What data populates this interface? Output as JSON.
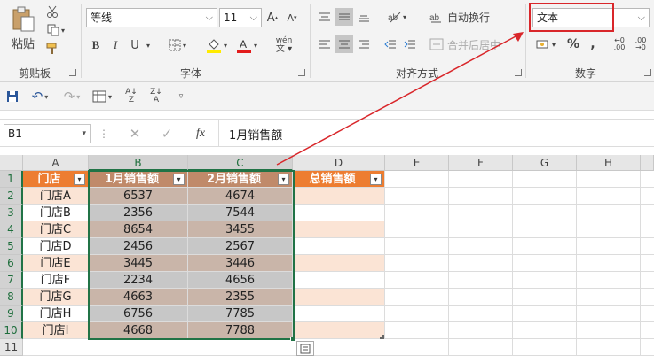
{
  "ribbon": {
    "clipboard": {
      "paste_label": "粘贴",
      "group_label": "剪贴板"
    },
    "font": {
      "font_name": "等线",
      "font_size": "11",
      "group_label": "字体",
      "bold": "B",
      "italic": "I",
      "underline": "U",
      "grow": "A",
      "shrink": "A",
      "phonetic": "wén"
    },
    "alignment": {
      "wrap_text": "自动换行",
      "merge_center": "合并后居中",
      "group_label": "对齐方式"
    },
    "number": {
      "format_value": "文本",
      "percent": "%",
      "comma": ",",
      "group_label": "数字"
    }
  },
  "formula_bar": {
    "name_box": "B1",
    "fx": "fx",
    "formula": "1月销售额"
  },
  "sheet": {
    "columns": [
      "A",
      "B",
      "C",
      "D",
      "E",
      "F",
      "G",
      "H"
    ],
    "rows": [
      "1",
      "2",
      "3",
      "4",
      "5",
      "6",
      "7",
      "8",
      "9",
      "10",
      "11"
    ],
    "headers": [
      "门店",
      "1月销售额",
      "2月销售额",
      "总销售额"
    ],
    "data": [
      {
        "store": "门店A",
        "jan": "6537",
        "feb": "4674"
      },
      {
        "store": "门店B",
        "jan": "2356",
        "feb": "7544"
      },
      {
        "store": "门店C",
        "jan": "8654",
        "feb": "3455"
      },
      {
        "store": "门店D",
        "jan": "2456",
        "feb": "2567"
      },
      {
        "store": "门店E",
        "jan": "3445",
        "feb": "3446"
      },
      {
        "store": "门店F",
        "jan": "2234",
        "feb": "4656"
      },
      {
        "store": "门店G",
        "jan": "4663",
        "feb": "2355"
      },
      {
        "store": "门店H",
        "jan": "6756",
        "feb": "7785"
      },
      {
        "store": "门店I",
        "jan": "4668",
        "feb": "7788"
      }
    ]
  },
  "colors": {
    "header_orange": "#ed7d31",
    "band_light": "#fbe4d5",
    "selection_green": "#217346",
    "annotation_red": "#d9262a"
  }
}
